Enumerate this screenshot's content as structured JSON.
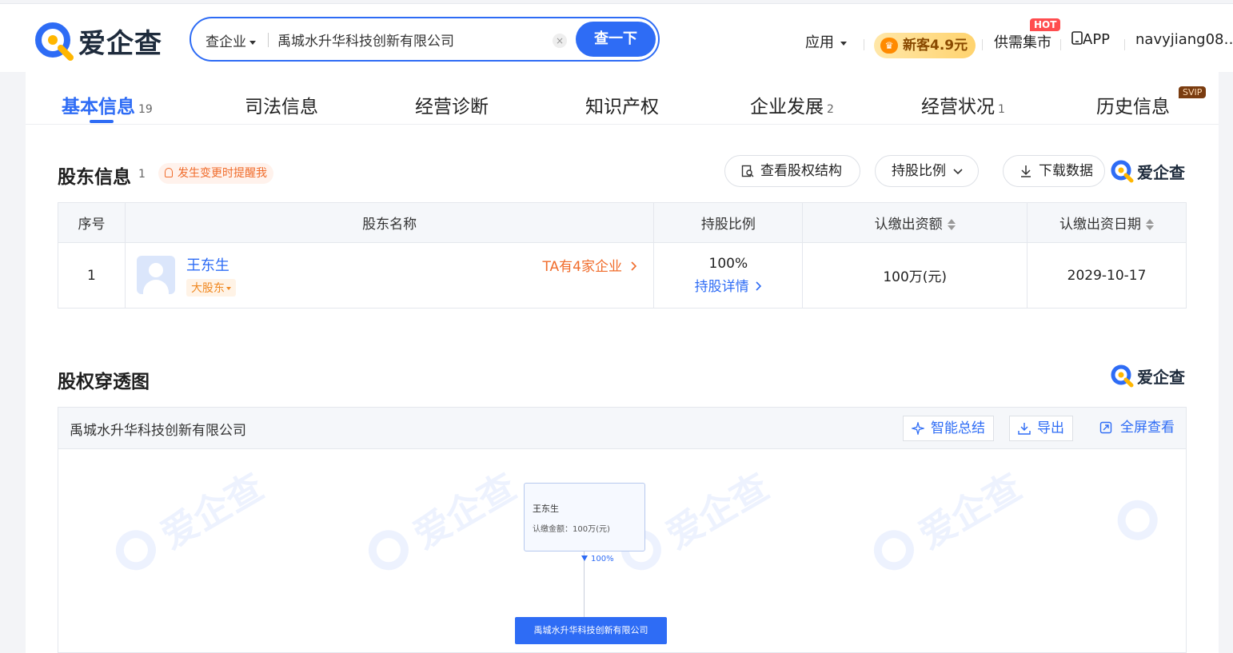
{
  "brand": {
    "name": "爱企查",
    "color": "#2e6cf5",
    "accent": "#ffb600"
  },
  "search": {
    "type_label": "查企业",
    "value": "禹城水升华科技创新有限公司",
    "clear_icon": "×",
    "button_label": "查一下"
  },
  "topnav": {
    "app_label": "应用",
    "promo_label": "新客4.9元",
    "promo_icon": "crown-icon",
    "market_label": "供需集市",
    "hot_badge": "HOT",
    "app_download_label": "APP",
    "user_label": "navyjiang08…"
  },
  "tabs": [
    {
      "label": "基本信息",
      "count": "19",
      "active": true
    },
    {
      "label": "司法信息",
      "count": ""
    },
    {
      "label": "经营诊断",
      "count": ""
    },
    {
      "label": "知识产权",
      "count": ""
    },
    {
      "label": "企业发展",
      "count": "2"
    },
    {
      "label": "经营状况",
      "count": "1"
    },
    {
      "label": "历史信息",
      "count": "",
      "badge": "SVIP"
    }
  ],
  "shareholders": {
    "title": "股东信息",
    "count": "1",
    "remind_label": "发生变更时提醒我",
    "btn_structure": "查看股权结构",
    "btn_ratio": "持股比例",
    "btn_download": "下载数据",
    "columns": [
      "序号",
      "股东名称",
      "持股比例",
      "认缴出资额",
      "认缴出资日期"
    ],
    "rows": [
      {
        "index": "1",
        "name": "王东生",
        "tag": "大股东",
        "companies_link": "TA有4家企业",
        "ratio": "100%",
        "ratio_detail": "持股详情",
        "amount": "100万(元)",
        "date": "2029-10-17"
      }
    ]
  },
  "equity_graph": {
    "title": "股权穿透图",
    "company": "禹城水升华科技创新有限公司",
    "btn_summary": "智能总结",
    "btn_export": "导出",
    "btn_fullscreen": "全屏查看",
    "person_name": "王东生",
    "person_amount": "认缴金额：100万(元)",
    "edge_percent": "100%",
    "target_company": "禹城水升华科技创新有限公司",
    "watermark": "爱企查"
  }
}
